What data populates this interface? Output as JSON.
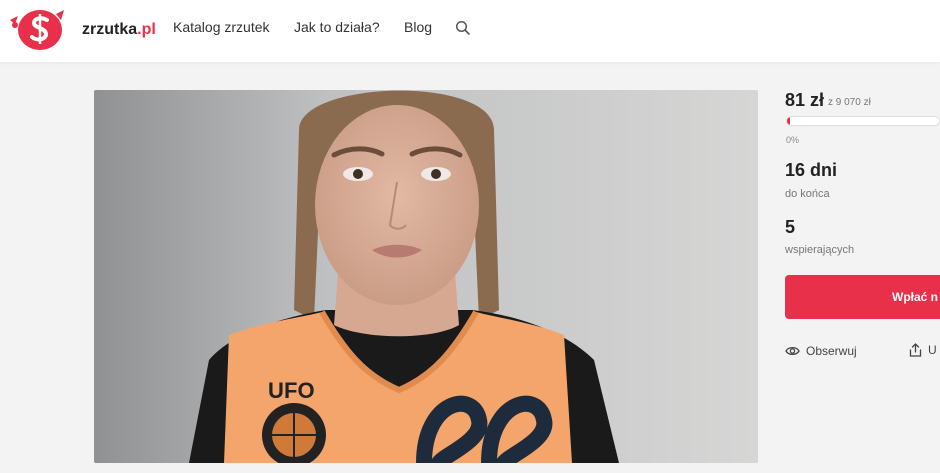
{
  "header": {
    "logo": {
      "name": "zrzutka",
      "tld": ".pl"
    },
    "nav": [
      "Katalog zrzutek",
      "Jak to działa?",
      "Blog"
    ],
    "search_icon": "search-icon"
  },
  "campaign": {
    "image_alt": "",
    "amount": "81 zł",
    "goal": "z 9 070 zł",
    "progress_percent": 0.9,
    "progress_label": "0%",
    "days": "16 dni",
    "days_label": "do końca",
    "supporters": "5",
    "supporters_label": "wspierających",
    "pay_label": "Wpłać n",
    "observe_label": "Obserwuj",
    "share_label": "U"
  },
  "colors": {
    "accent": "#e8304a",
    "header_bg": "#ffffff",
    "page_bg": "#f3f3f3"
  }
}
